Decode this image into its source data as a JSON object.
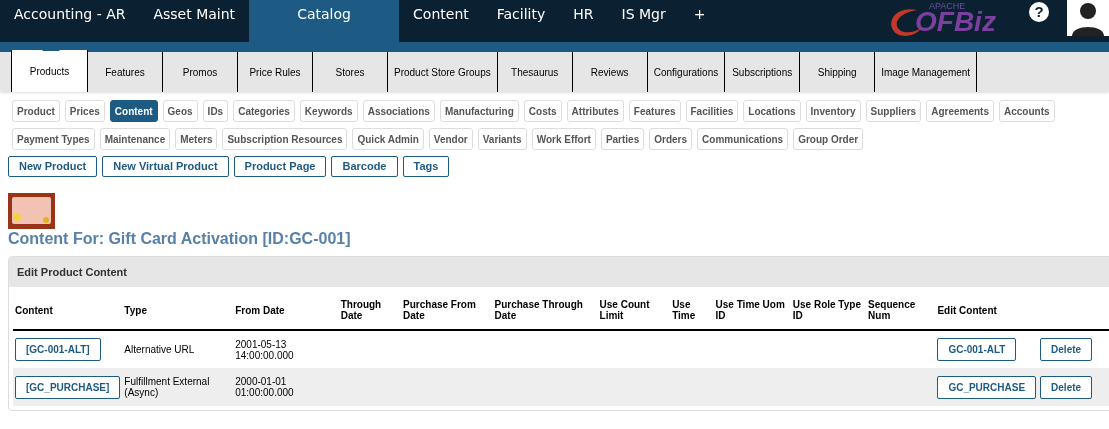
{
  "top_nav": [
    {
      "label": "Accounting - AR",
      "selected": false
    },
    {
      "label": "Asset Maint",
      "selected": false
    },
    {
      "label": "Catalog",
      "selected": true
    },
    {
      "label": "Content",
      "selected": false
    },
    {
      "label": "Facility",
      "selected": false
    },
    {
      "label": "HR",
      "selected": false
    },
    {
      "label": "IS Mgr",
      "selected": false
    },
    {
      "label": "+",
      "selected": false
    }
  ],
  "logo": {
    "small": "APACHE",
    "main": "OFBiz"
  },
  "help": "?",
  "main_tabs": [
    {
      "label": "Products",
      "selected": true
    },
    {
      "label": "Features",
      "selected": false
    },
    {
      "label": "Promos",
      "selected": false
    },
    {
      "label": "Price Rules",
      "selected": false
    },
    {
      "label": "Stores",
      "selected": false
    },
    {
      "label": "Product Store Groups",
      "selected": false
    },
    {
      "label": "Thesaurus",
      "selected": false
    },
    {
      "label": "Reviews",
      "selected": false
    },
    {
      "label": "Configurations",
      "selected": false
    },
    {
      "label": "Subscriptions",
      "selected": false
    },
    {
      "label": "Shipping",
      "selected": false
    },
    {
      "label": "Image Management",
      "selected": false
    }
  ],
  "sub_nav": [
    [
      {
        "label": "Product",
        "selected": false
      },
      {
        "label": "Prices",
        "selected": false
      },
      {
        "label": "Content",
        "selected": true
      },
      {
        "label": "Geos",
        "selected": false
      },
      {
        "label": "IDs",
        "selected": false
      },
      {
        "label": "Categories",
        "selected": false
      },
      {
        "label": "Keywords",
        "selected": false
      },
      {
        "label": "Associations",
        "selected": false
      },
      {
        "label": "Manufacturing",
        "selected": false
      },
      {
        "label": "Costs",
        "selected": false
      },
      {
        "label": "Attributes",
        "selected": false
      },
      {
        "label": "Features",
        "selected": false
      },
      {
        "label": "Facilities",
        "selected": false
      },
      {
        "label": "Locations",
        "selected": false
      },
      {
        "label": "Inventory",
        "selected": false
      },
      {
        "label": "Suppliers",
        "selected": false
      },
      {
        "label": "Agreements",
        "selected": false
      },
      {
        "label": "Accounts",
        "selected": false
      }
    ],
    [
      {
        "label": "Payment Types",
        "selected": false
      },
      {
        "label": "Maintenance",
        "selected": false
      },
      {
        "label": "Meters",
        "selected": false
      },
      {
        "label": "Subscription Resources",
        "selected": false
      },
      {
        "label": "Quick Admin",
        "selected": false
      },
      {
        "label": "Vendor",
        "selected": false
      },
      {
        "label": "Variants",
        "selected": false
      },
      {
        "label": "Work Effort",
        "selected": false
      },
      {
        "label": "Parties",
        "selected": false
      },
      {
        "label": "Orders",
        "selected": false
      },
      {
        "label": "Communications",
        "selected": false
      },
      {
        "label": "Group Order",
        "selected": false
      }
    ]
  ],
  "actions": [
    "New Product",
    "New Virtual Product",
    "Product Page",
    "Barcode",
    "Tags"
  ],
  "title": "Content For: Gift Card Activation [ID:GC-001]",
  "panel": {
    "title": "Edit Product Content",
    "columns": [
      "Content",
      "Type",
      "From Date",
      "Through Date",
      "Purchase From Date",
      "Purchase Through Date",
      "Use Count Limit",
      "Use Time",
      "Use Time Uom ID",
      "Use Role Type ID",
      "Sequence Num",
      "Edit Content"
    ],
    "rows": [
      {
        "content": "[GC-001-ALT]",
        "type": "Alternative URL",
        "from_date": "2001-05-13 14:00:00.000",
        "edit": "GC-001-ALT",
        "delete": "Delete"
      },
      {
        "content": "[GC_PURCHASE]",
        "type": "Fulfillment External (Async)",
        "from_date": "2000-01-01 01:00:00.000",
        "edit": "GC_PURCHASE",
        "delete": "Delete"
      }
    ]
  }
}
